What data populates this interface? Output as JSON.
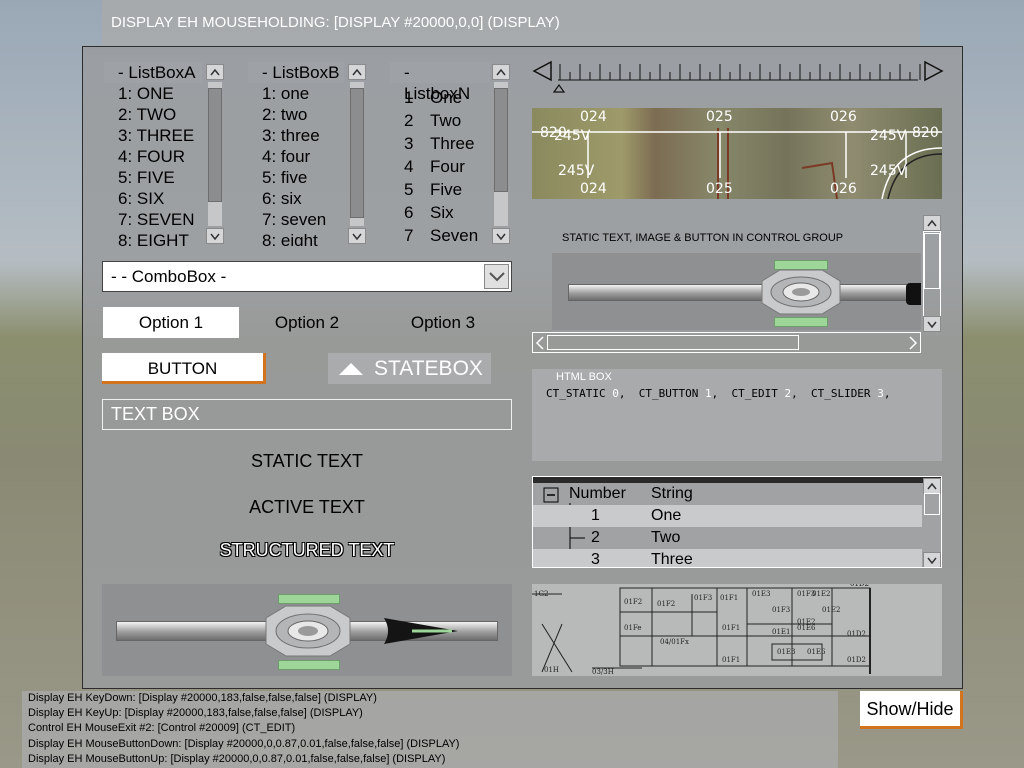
{
  "title": "DISPLAY EH MOUSEHOLDING: [DISPLAY #20000,0,0] (DISPLAY)",
  "listbox_a": {
    "header": "- ListBoxA",
    "items": [
      "1: ONE",
      "2: TWO",
      "3: THREE",
      "4: FOUR",
      "5: FIVE",
      "6: SIX",
      "7: SEVEN",
      "8: EIGHT"
    ]
  },
  "listbox_b": {
    "header": "- ListBoxB",
    "items": [
      "1: one",
      "2: two",
      "3: three",
      "4: four",
      "5: five",
      "6: six",
      "7: seven",
      "8: eight"
    ]
  },
  "listbox_n": {
    "header_dash": "-",
    "header": "ListboxN",
    "items": [
      {
        "num": "1",
        "label": "One"
      },
      {
        "num": "2",
        "label": "Two"
      },
      {
        "num": "3",
        "label": "Three"
      },
      {
        "num": "4",
        "label": "Four"
      },
      {
        "num": "5",
        "label": "Five"
      },
      {
        "num": "6",
        "label": "Six"
      },
      {
        "num": "7",
        "label": "Seven"
      }
    ]
  },
  "combobox": {
    "value": "- - ComboBox -"
  },
  "toolbox": {
    "options": [
      "Option 1",
      "Option 2",
      "Option 3"
    ],
    "selected_index": 0
  },
  "button_label": "BUTTON",
  "statebox_label": "STATEBOX",
  "textbox_value": "TEXT BOX",
  "static_text": "STATIC TEXT",
  "active_text": "ACTIVE TEXT",
  "structured_text": "STRUCTURED TEXT",
  "map": {
    "top_labels": [
      "024",
      "025",
      "026"
    ],
    "bottom_labels": [
      "024",
      "025",
      "026"
    ],
    "left_value": "820",
    "right_value": "820",
    "heading_labels": [
      "245V",
      "245V",
      "245V",
      "245V"
    ]
  },
  "control_group": {
    "label": "STATIC TEXT, IMAGE & BUTTON IN CONTROL GROUP"
  },
  "html_box": {
    "title": "HTML BOX",
    "entries": [
      {
        "name": "CT_STATIC",
        "value": "0"
      },
      {
        "name": "CT_BUTTON",
        "value": "1"
      },
      {
        "name": "CT_EDIT",
        "value": "2"
      },
      {
        "name": "CT_SLIDER",
        "value": "3"
      }
    ]
  },
  "tree": {
    "columns": [
      "Number",
      "String"
    ],
    "rows": [
      {
        "number": "1",
        "string": "One"
      },
      {
        "number": "2",
        "string": "Two"
      },
      {
        "number": "3",
        "string": "Three"
      }
    ]
  },
  "blueprint": {
    "labels": [
      "01F2",
      "01Fe",
      "01F2",
      "01F3",
      "01F1",
      "04/01Fx",
      "01F1",
      "01F1",
      "01E3",
      "01F3",
      "01F3",
      "01E2",
      "01E2",
      "01E2",
      "01E6",
      "01E1",
      "01E6",
      "01E3",
      "01D2",
      "01D2",
      "01D2",
      "01H",
      "03/3H",
      "1G2"
    ]
  },
  "log_lines": [
    "Display EH KeyDown: [Display #20000,183,false,false,false] (DISPLAY)",
    "Display EH KeyUp: [Display #20000,183,false,false,false] (DISPLAY)",
    "Control EH MouseExit #2: [Control #20009] (CT_EDIT)",
    "Display EH MouseButtonDown: [Display #20000,0,0.87,0.01,false,false,false] (DISPLAY)",
    "Display EH MouseButtonUp: [Display #20000,0,0.87,0.01,false,false,false] (DISPLAY)"
  ],
  "show_hide_label": "Show/Hide",
  "colors": {
    "accent_orange": "#d2731f",
    "panel_gray": "#9a9c9e",
    "pad_green": "#9ed69a"
  }
}
